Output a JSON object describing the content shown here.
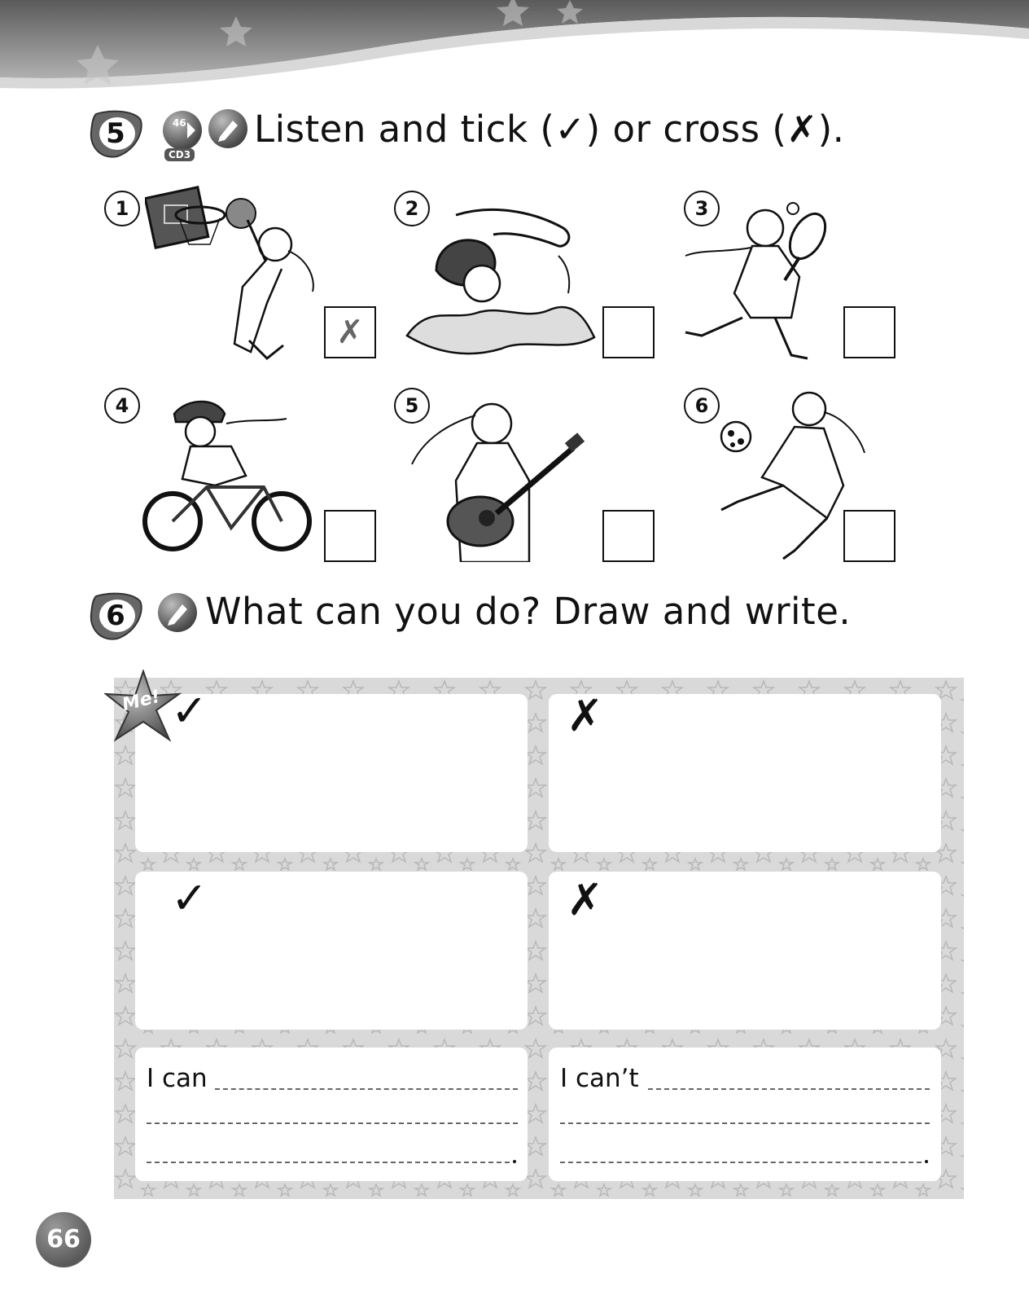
{
  "exercise5": {
    "number": "5",
    "track": "46",
    "cd": "CD3",
    "instruction": "Listen and tick (✓) or cross (✗).",
    "items": [
      {
        "num": "1",
        "activity": "basketball",
        "answer": "✗"
      },
      {
        "num": "2",
        "activity": "swimming",
        "answer": ""
      },
      {
        "num": "3",
        "activity": "tennis",
        "answer": ""
      },
      {
        "num": "4",
        "activity": "cycling",
        "answer": ""
      },
      {
        "num": "5",
        "activity": "guitar",
        "answer": ""
      },
      {
        "num": "6",
        "activity": "football",
        "answer": ""
      }
    ]
  },
  "exercise6": {
    "number": "6",
    "instruction": "What can you do? Draw and write.",
    "badge": "Me!",
    "tick": "✓",
    "cross": "✗",
    "can_label": "I can",
    "cant_label": "I can’t"
  },
  "footer": {
    "page_number": "66"
  },
  "colors": {
    "panel": "#d9d9d9",
    "ink": "#111111",
    "banner": "#6e6e6e"
  }
}
